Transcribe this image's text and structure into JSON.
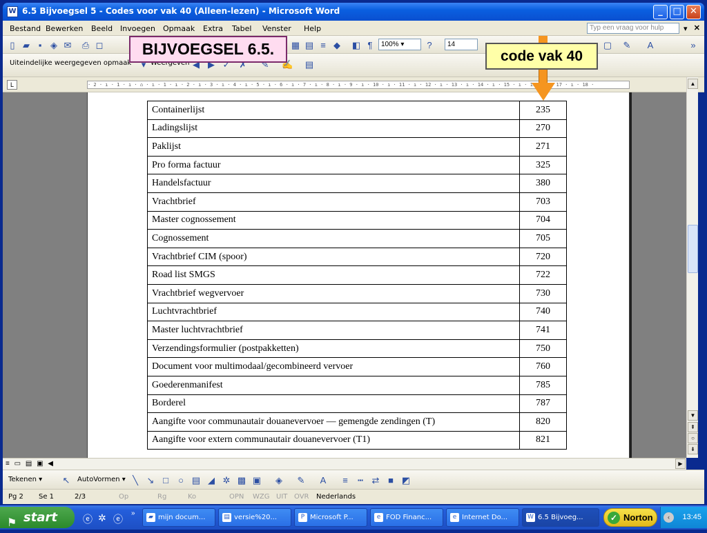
{
  "window": {
    "title": "6.5 Bijvoegsel 5 - Codes voor vak 40 (Alleen-lezen) - Microsoft Word",
    "icon": "word-doc-icon"
  },
  "menubar": {
    "items": [
      "Bestand",
      "Bewerken",
      "Beeld",
      "Invoegen",
      "Opmaak",
      "Extra",
      "Tabel",
      "Venster",
      "Help"
    ],
    "help_placeholder": "Typ een vraag voor hulp"
  },
  "toolbar": {
    "zoom": "100%",
    "font_size": "14"
  },
  "toolbar2": {
    "style_value": "Uiteindelijke weergegeven opmaak",
    "view_label": "Weergeven"
  },
  "ruler": {
    "ticks": "· 2 · ı · 1 · ı · ⌂ · ı · 1 · ı · 2 · ı · 3 · ı · 4 · ı · 5 · ı · 6 · ı · 7 · ı · 8 · ı · 9 · ı · 10 · ı · 11 · ı · 12 · ı · 13 · ı · 14 · ı · 15 · ı · 16 · ı · 17 · ı · 18 ·"
  },
  "callouts": {
    "appendix": "BIJVOEGSEL 6.5.",
    "code_label": "code vak 40"
  },
  "table": {
    "rows": [
      {
        "name": "Containerlijst",
        "code": "235"
      },
      {
        "name": "Ladingslijst",
        "code": "270"
      },
      {
        "name": "Paklijst",
        "code": "271"
      },
      {
        "name": "Pro forma factuur",
        "code": "325"
      },
      {
        "name": "Handelsfactuur",
        "code": "380"
      },
      {
        "name": "Vrachtbrief",
        "code": "703"
      },
      {
        "name": "Master cognossement",
        "code": "704"
      },
      {
        "name": "Cognossement",
        "code": "705"
      },
      {
        "name": "Vrachtbrief CIM (spoor)",
        "code": "720"
      },
      {
        "name": "Road list SMGS",
        "code": "722"
      },
      {
        "name": "Vrachtbrief wegvervoer",
        "code": "730"
      },
      {
        "name": "Luchtvrachtbrief",
        "code": "740"
      },
      {
        "name": "Master luchtvrachtbrief",
        "code": "741"
      },
      {
        "name": "Verzendingsformulier (postpakketten)",
        "code": "750"
      },
      {
        "name": "Document voor multimodaal/gecombineerd vervoer",
        "code": "760"
      },
      {
        "name": "Goederenmanifest",
        "code": "785"
      },
      {
        "name": "Borderel",
        "code": "787"
      },
      {
        "name": "Aangifte voor communautair douanevervoer — gemengde zendingen (T)",
        "code": "820"
      },
      {
        "name": "Aangifte voor extern communautair douanevervoer (T1)",
        "code": "821"
      }
    ]
  },
  "drawbar": {
    "draw_label": "Tekenen",
    "autoshapes_label": "AutoVormen"
  },
  "status": {
    "page": "Pg 2",
    "section": "Se 1",
    "pages": "2/3",
    "at": "Op",
    "line": "Rg",
    "col": "Ko",
    "rec": "OPN",
    "trk": "WZG",
    "ext": "UIT",
    "ovr": "OVR",
    "language": "Nederlands"
  },
  "taskbar": {
    "start": "start",
    "tasks": [
      "mijn docum...",
      "versie%20...",
      "Microsoft P...",
      "FOD Financ...",
      "Internet Do...",
      "6.5 Bijvoeg..."
    ],
    "norton": "Norton",
    "clock": "13:45"
  }
}
